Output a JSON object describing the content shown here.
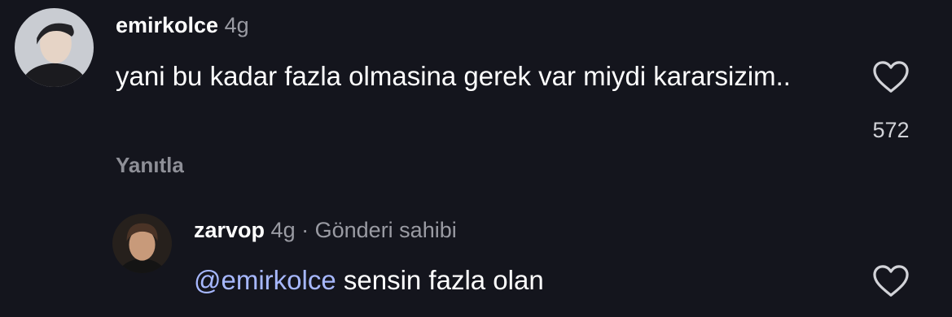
{
  "comments": [
    {
      "username": "emirkolce",
      "time": "4g",
      "text": "yani bu kadar fazla olmasina gerek var miydi kararsizim..",
      "reply_label": "Yanıtla",
      "like_count": "572",
      "avatar_icon": "user-avatar-photo"
    },
    {
      "username": "zarvop",
      "time": "4g",
      "separator": "·",
      "author_badge": "Gönderi sahibi",
      "mention": "@emirkolce",
      "text": " sensin fazla olan",
      "avatar_icon": "user-avatar-photo"
    }
  ],
  "icons": {
    "like": "heart-outline-icon"
  },
  "colors": {
    "background": "#14151d",
    "mention": "#a7b8ff",
    "muted": "#9a9ba3"
  }
}
